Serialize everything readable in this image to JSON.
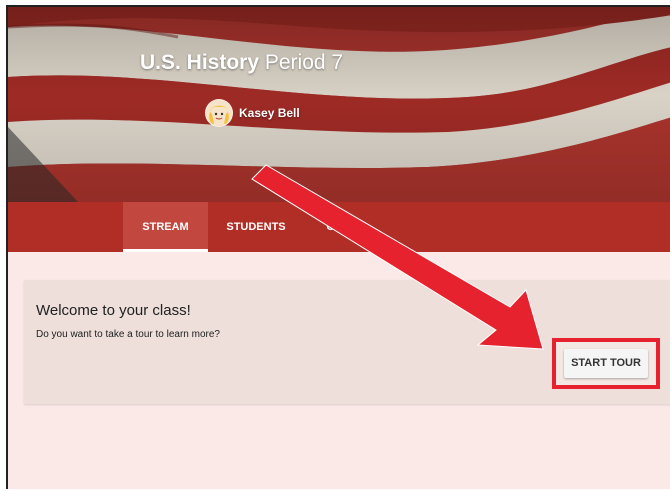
{
  "header": {
    "title_bold": "U.S. History",
    "title_rest": " Period 7",
    "teacher_name": "Kasey Bell",
    "avatar_icon": "teacher-avatar-icon"
  },
  "tabs": [
    {
      "label": "STREAM",
      "active": true
    },
    {
      "label": "STUDENTS",
      "active": false
    },
    {
      "label": "OUT",
      "active": false
    }
  ],
  "welcome": {
    "title": "Welcome to your class!",
    "subtitle": "Do you want to take a tour to learn more?",
    "button_label": "START TOUR"
  },
  "annotation": {
    "arrow_icon": "red-arrow-icon",
    "color": "#e5222d"
  },
  "colors": {
    "banner": "#a9302a",
    "tabbar": "#b12e26",
    "page_bg": "#fbe9e7"
  }
}
